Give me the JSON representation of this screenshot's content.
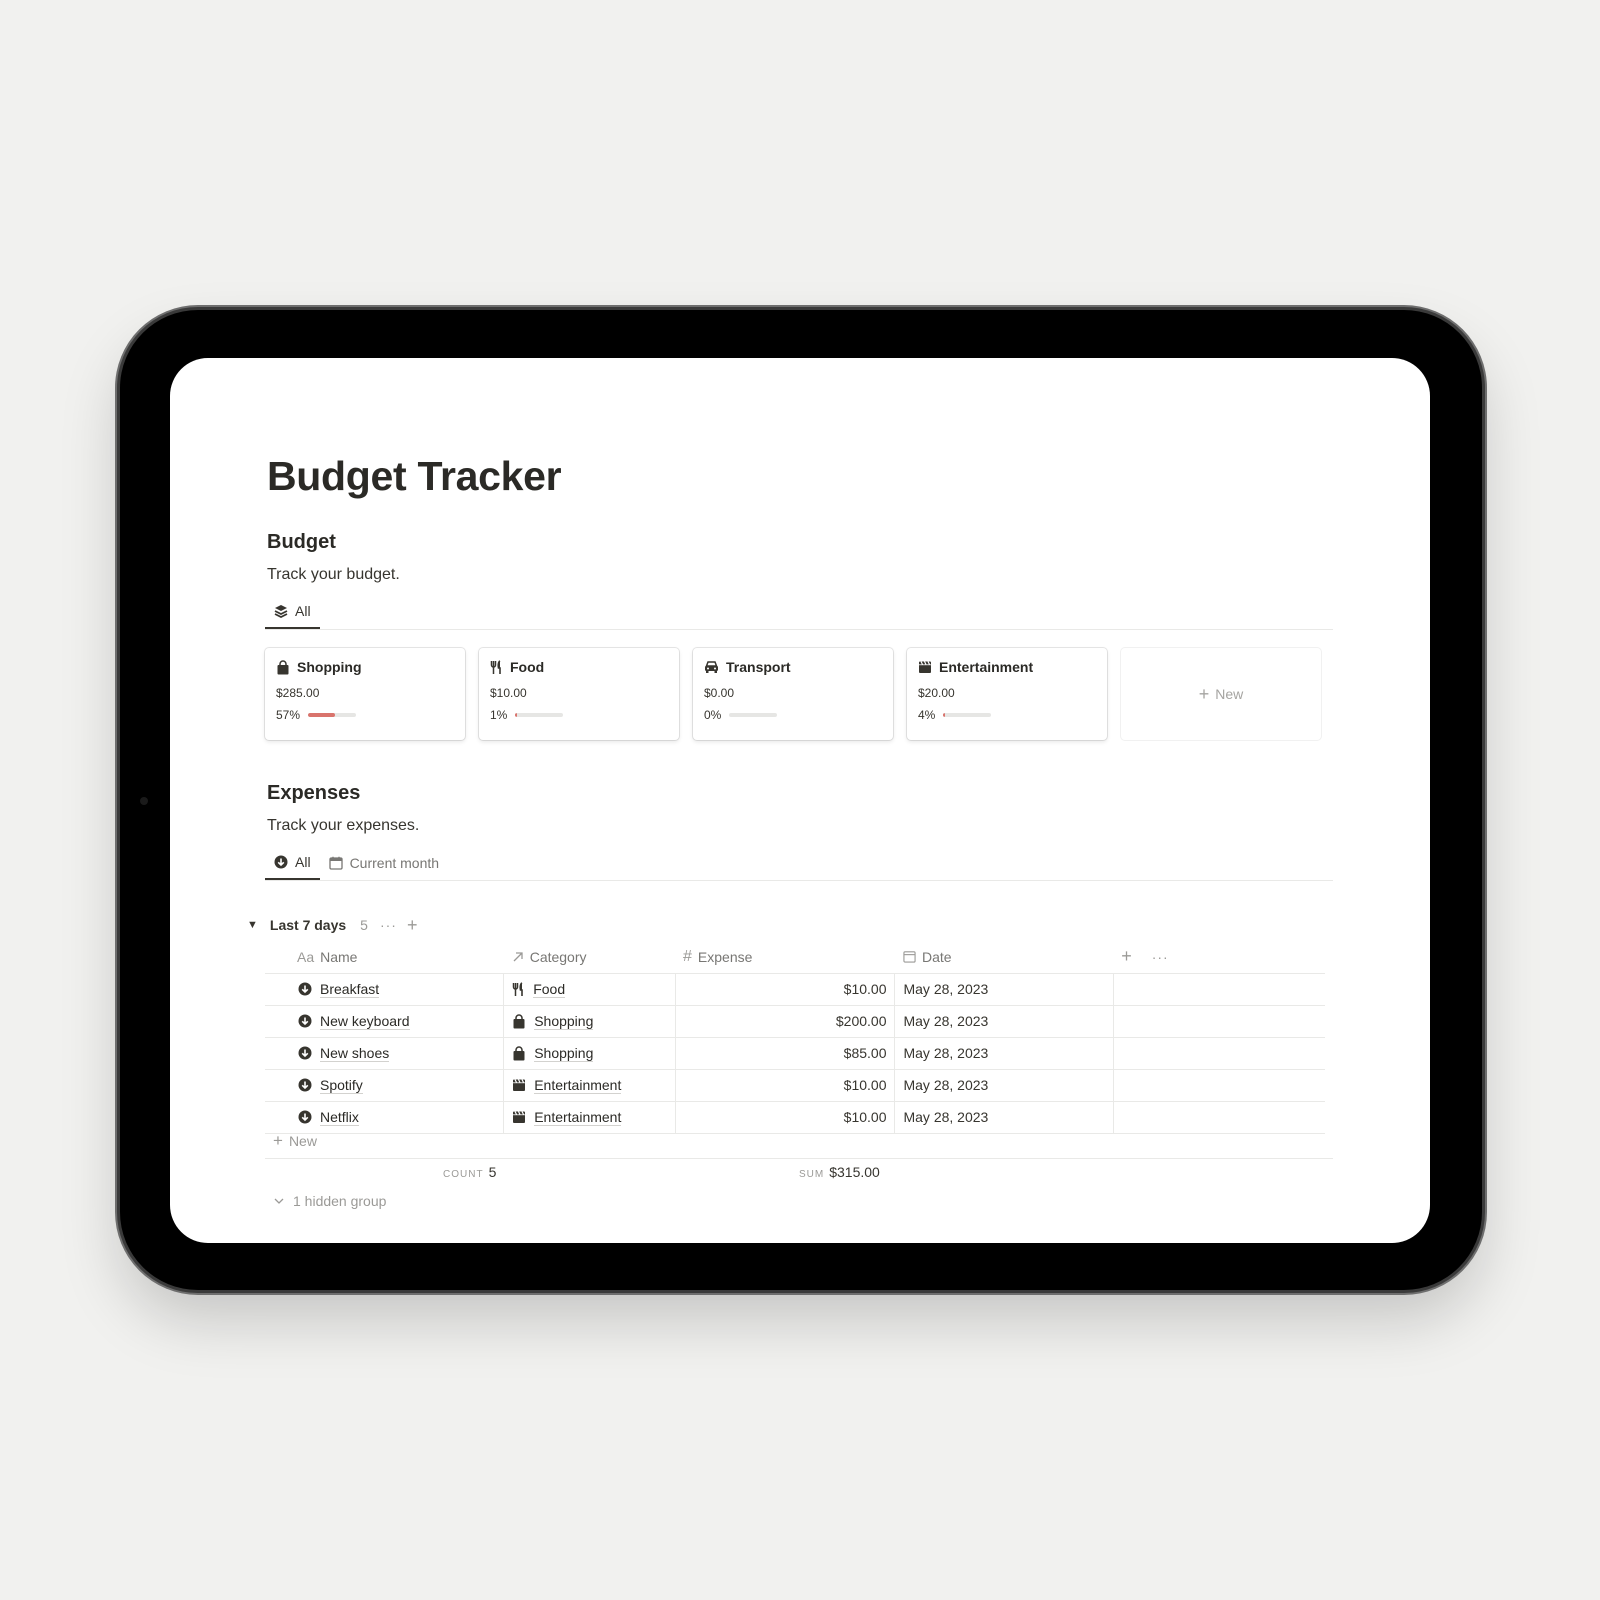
{
  "page": {
    "title": "Budget Tracker"
  },
  "budget": {
    "heading": "Budget",
    "description": "Track your budget.",
    "tabs": [
      {
        "label": "All",
        "icon": "layers-icon",
        "active": true
      }
    ],
    "cards": [
      {
        "icon": "shopping-bag-icon",
        "label": "Shopping",
        "amount": "$285.00",
        "percent_label": "57%",
        "progress": 0.57,
        "bar_color": "#d9736c"
      },
      {
        "icon": "fork-knife-icon",
        "label": "Food",
        "amount": "$10.00",
        "percent_label": "1%",
        "progress": 0.01,
        "bar_color": "#d9736c"
      },
      {
        "icon": "car-icon",
        "label": "Transport",
        "amount": "$0.00",
        "percent_label": "0%",
        "progress": 0.0,
        "bar_color": "#d9736c"
      },
      {
        "icon": "clapperboard-icon",
        "label": "Entertainment",
        "amount": "$20.00",
        "percent_label": "4%",
        "progress": 0.04,
        "bar_color": "#d9736c"
      }
    ],
    "new_label": "New"
  },
  "expenses": {
    "heading": "Expenses",
    "description": "Track your expenses.",
    "tabs": [
      {
        "label": "All",
        "icon": "arrow-down-circle-icon",
        "active": true
      },
      {
        "label": "Current month",
        "icon": "calendar-icon",
        "active": false
      }
    ],
    "group": {
      "label": "Last 7 days",
      "count": "5",
      "more": "···",
      "add": "+"
    },
    "columns": [
      {
        "label": "Name",
        "icon_text": "Aa"
      },
      {
        "label": "Category",
        "icon": "relation-arrow-icon"
      },
      {
        "label": "Expense",
        "icon_text": "#"
      },
      {
        "label": "Date",
        "icon": "calendar-icon"
      }
    ],
    "rows": [
      {
        "name": "Breakfast",
        "category": "Food",
        "category_icon": "fork-knife-icon",
        "expense": "$10.00",
        "date": "May 28, 2023"
      },
      {
        "name": "New keyboard",
        "category": "Shopping",
        "category_icon": "shopping-bag-icon",
        "expense": "$200.00",
        "date": "May 28, 2023"
      },
      {
        "name": "New shoes",
        "category": "Shopping",
        "category_icon": "shopping-bag-icon",
        "expense": "$85.00",
        "date": "May 28, 2023"
      },
      {
        "name": "Spotify",
        "category": "Entertainment",
        "category_icon": "clapperboard-icon",
        "expense": "$10.00",
        "date": "May 28, 2023"
      },
      {
        "name": "Netflix",
        "category": "Entertainment",
        "category_icon": "clapperboard-icon",
        "expense": "$10.00",
        "date": "May 28, 2023"
      }
    ],
    "new_label": "New",
    "count": {
      "key": "COUNT",
      "value": "5"
    },
    "sum": {
      "key": "SUM",
      "value": "$315.00"
    },
    "hidden_groups": "1 hidden group"
  }
}
